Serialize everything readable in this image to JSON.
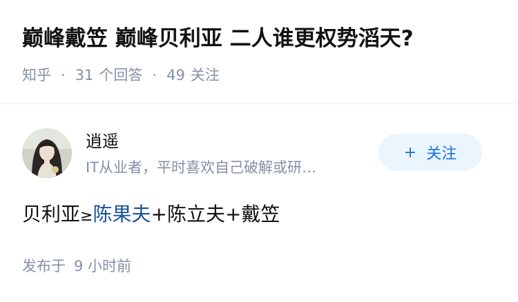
{
  "question": {
    "title": "巅峰戴笠 巅峰贝利亚 二人谁更权势滔天?",
    "source": "知乎",
    "answer_count": "31",
    "answer_label": "个回答",
    "follower_count": "49",
    "follower_label": "关注",
    "separator": "·"
  },
  "answer": {
    "author": {
      "name": "逍遥",
      "bio": "IT从业者，平时喜欢自己破解或研…",
      "avatar_icon": "avatar-photo"
    },
    "follow_button": {
      "icon": "+",
      "label": "关注"
    },
    "content": {
      "part1": "贝利亚",
      "rel": "≥",
      "link": "陈果夫",
      "plus1": "+",
      "part2": "陈立夫",
      "plus2": "+",
      "part3": "戴笠"
    },
    "publish": {
      "label": "发布于",
      "time": "9 小时前"
    }
  },
  "colors": {
    "meta_gray": "#8590a6",
    "link_blue": "#175199",
    "button_bg": "#ebf5fd",
    "button_text": "#1772d9"
  }
}
